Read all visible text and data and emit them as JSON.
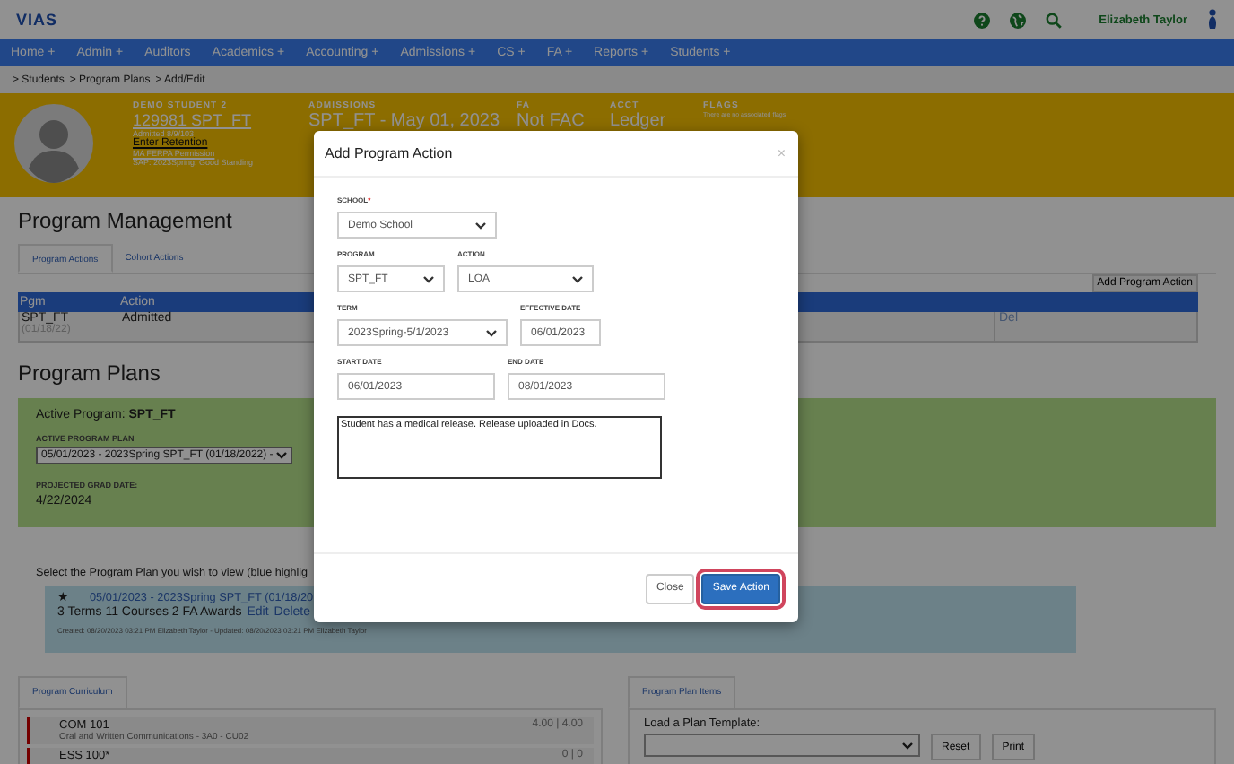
{
  "topbar": {
    "logo": "VIAS",
    "user": "Elizabeth Taylor"
  },
  "nav": [
    {
      "label": "Home +"
    },
    {
      "label": "Admin +"
    },
    {
      "label": "Auditors"
    },
    {
      "label": "Academics +"
    },
    {
      "label": "Accounting +"
    },
    {
      "label": "Admissions +"
    },
    {
      "label": "CS +"
    },
    {
      "label": "FA +"
    },
    {
      "label": "Reports +"
    },
    {
      "label": "Students +"
    }
  ],
  "breadcrumb": [
    "> Students",
    "> Program Plans",
    "> Add/Edit"
  ],
  "student": {
    "name": "DEMO STUDENT 2",
    "id": "129981 SPT_FT",
    "admitted": "Admitted 8/9/103",
    "links": [
      "Enter Retention",
      "MA FERPA Permission"
    ],
    "sap": "SAP: 2023Spring: Good Standing"
  },
  "header_fields": [
    {
      "label": "ADMISSIONS",
      "value": "SPT_FT - May 01, 2023"
    },
    {
      "label": "FA",
      "value": "Not FAC"
    },
    {
      "label": "ACCT",
      "value": "Ledger"
    },
    {
      "label": "FLAGS",
      "note": "There are no associated flags"
    }
  ],
  "program_management": {
    "title": "Program Management",
    "tabs": [
      {
        "label": "Program Actions",
        "selected": true
      },
      {
        "label": "Cohort Actions",
        "selected": false
      }
    ],
    "add_button": "Add Program Action",
    "columns": [
      "Pgm",
      "Action"
    ],
    "rows": [
      {
        "program": "SPT_FT",
        "date": "(01/18/22)",
        "action": "Admitted",
        "delete": "Del"
      }
    ]
  },
  "program_plans": {
    "title": "Program Plans",
    "active": "Active Program: **SPT_FT**",
    "plan_label": "ACTIVE PROGRAM PLAN",
    "plan_value": "05/01/2023 - 2023Spring SPT_FT (01/18/2022) -",
    "grad_label": "PROJECTED GRAD DATE:",
    "grad_value": "4/22/2024",
    "instruction": "Select the Program Plan you wish to view (blue highlig",
    "plans": [
      {
        "selected": true,
        "star": "★",
        "title": "05/01/2023 - 2023Spring SPT_FT (01/18/20",
        "summary": "3 Terms 11 Courses 2 FA Awards",
        "actions": [
          "Edit",
          "Delete"
        ],
        "meta": "Created: 08/20/2023 03:21 PM Elizabeth Taylor - Updated: 08/20/2023 03:21 PM Elizabeth Taylor"
      }
    ]
  },
  "curriculum": {
    "tab": "Program Curriculum",
    "courses": [
      {
        "code": "COM 101",
        "desc": "Oral and Written Communications - 3A0 - CU02",
        "credits": "4.00 | 4.00"
      },
      {
        "code": "ESS 100*",
        "credits": "0 | 0"
      }
    ]
  },
  "plan_items": {
    "tab": "Program Plan Items",
    "template_label": "Load a Plan Template:",
    "buttons": [
      "Reset",
      "Print"
    ]
  },
  "modal": {
    "title": "Add Program Action",
    "close": "×",
    "rows": [
      [
        {
          "label": "SCHOOL",
          "required_mark": "*",
          "kind": "select",
          "value": "Demo School"
        }
      ],
      [
        {
          "label": "PROGRAM",
          "kind": "select",
          "value": "SPT_FT"
        },
        {
          "label": "ACTION",
          "kind": "select",
          "value": "LOA"
        }
      ],
      [
        {
          "label": "TERM",
          "kind": "select",
          "value": "2023Spring-5/1/2023"
        },
        {
          "label": "EFFECTIVE DATE",
          "kind": "date",
          "value": "06/01/2023"
        }
      ],
      [
        {
          "label": "START DATE",
          "kind": "date",
          "value": "06/01/2023"
        },
        {
          "label": "END DATE",
          "kind": "date",
          "value": "08/01/2023"
        }
      ]
    ],
    "notes": "Student has a medical release.  Release uploaded in Docs.",
    "buttons": [
      {
        "label": "Close",
        "kind": "secondary",
        "focused": false
      },
      {
        "label": "Save Action",
        "kind": "primary",
        "focused": true
      }
    ]
  }
}
